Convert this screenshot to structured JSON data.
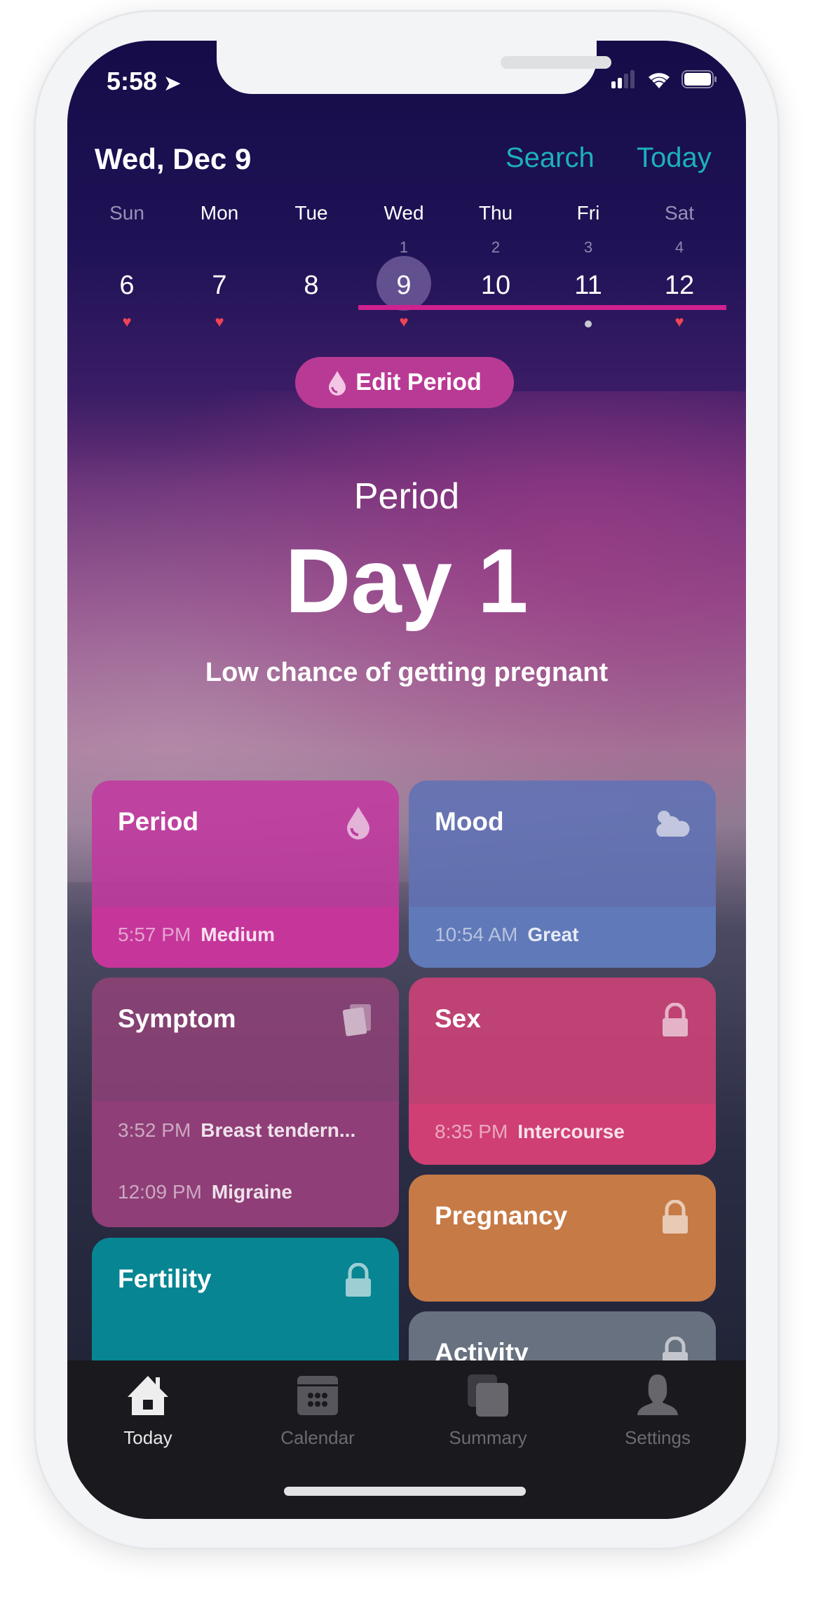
{
  "status": {
    "time": "5:58"
  },
  "header": {
    "date": "Wed, Dec 9",
    "search": "Search",
    "today": "Today"
  },
  "week": {
    "days": [
      {
        "name": "Sun",
        "date": "6",
        "cycle": "",
        "mark": "heart"
      },
      {
        "name": "Mon",
        "date": "7",
        "cycle": "",
        "mark": "heart"
      },
      {
        "name": "Tue",
        "date": "8",
        "cycle": "",
        "mark": ""
      },
      {
        "name": "Wed",
        "date": "9",
        "cycle": "1",
        "mark": "heart"
      },
      {
        "name": "Thu",
        "date": "10",
        "cycle": "2",
        "mark": ""
      },
      {
        "name": "Fri",
        "date": "11",
        "cycle": "3",
        "mark": "dot"
      },
      {
        "name": "Sat",
        "date": "12",
        "cycle": "4",
        "mark": "heart"
      }
    ],
    "selected": "9"
  },
  "edit_period": "Edit Period",
  "hero": {
    "label": "Period",
    "day": "Day 1",
    "chance": "Low chance of getting pregnant"
  },
  "cards": {
    "period": {
      "title": "Period",
      "entries": [
        {
          "time": "5:57 PM",
          "value": "Medium"
        }
      ],
      "color": "#c2399f"
    },
    "mood": {
      "title": "Mood",
      "entries": [
        {
          "time": "10:54 AM",
          "value": "Great"
        }
      ],
      "color": "#6272b5"
    },
    "symptom": {
      "title": "Symptom",
      "entries": [
        {
          "time": "3:52 PM",
          "value": "Breast tendern..."
        },
        {
          "time": "12:09 PM",
          "value": "Migraine"
        }
      ],
      "color": "#914278"
    },
    "sex": {
      "title": "Sex",
      "entries": [
        {
          "time": "8:35 PM",
          "value": "Intercourse"
        }
      ],
      "color": "#cc4377"
    },
    "fertility": {
      "title": "Fertility",
      "color": "#078592"
    },
    "pregnancy": {
      "title": "Pregnancy",
      "color": "#c67a46"
    },
    "activity": {
      "title": "Activity",
      "color": "#68717f"
    }
  },
  "tabs": [
    {
      "label": "Today",
      "icon": "house-icon",
      "active": true
    },
    {
      "label": "Calendar",
      "icon": "calendar-icon"
    },
    {
      "label": "Summary",
      "icon": "summary-icon"
    },
    {
      "label": "Settings",
      "icon": "person-icon"
    }
  ]
}
